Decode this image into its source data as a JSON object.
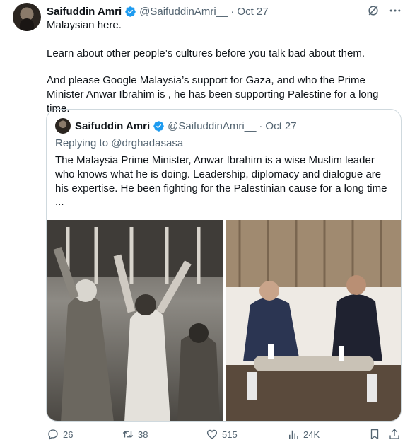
{
  "tweet": {
    "author_name": "Saifuddin Amri",
    "handle": "@SaifuddinAmri__",
    "separator": "·",
    "date": "Oct 27",
    "line1": "Malaysian here.",
    "line2": "Learn about other people’s cultures before you talk bad about them.",
    "line3": "And please Google Malaysia’s support for Gaza, and who the Prime Minister Anwar Ibrahim is , he has been supporting Palestine for a long time."
  },
  "quote": {
    "author_name": "Saifuddin Amri",
    "handle": "@SaifuddinAmri__",
    "separator": "·",
    "date": "Oct 27",
    "replying_to": "Replying to @drghadasasa",
    "text": "The Malaysia Prime Minister, Anwar Ibrahim is a wise Muslim leader who knows what he is doing. Leadership,  diplomacy and dialogue are his expertise. He been fighting for the Palestinian cause for a long time",
    "ellipsis": "..."
  },
  "actions": {
    "replies": "26",
    "retweets": "38",
    "likes": "515",
    "views": "24K"
  },
  "icons": {
    "verified": "verified-badge-icon",
    "grok": "grok-icon",
    "more": "more-icon",
    "reply": "reply-icon",
    "retweet": "retweet-icon",
    "like": "heart-icon",
    "views": "views-icon",
    "bookmark": "bookmark-icon",
    "share": "share-icon"
  },
  "colors": {
    "verified": "#1d9bf0",
    "secondary_text": "#536471",
    "border": "#cfd9de"
  }
}
